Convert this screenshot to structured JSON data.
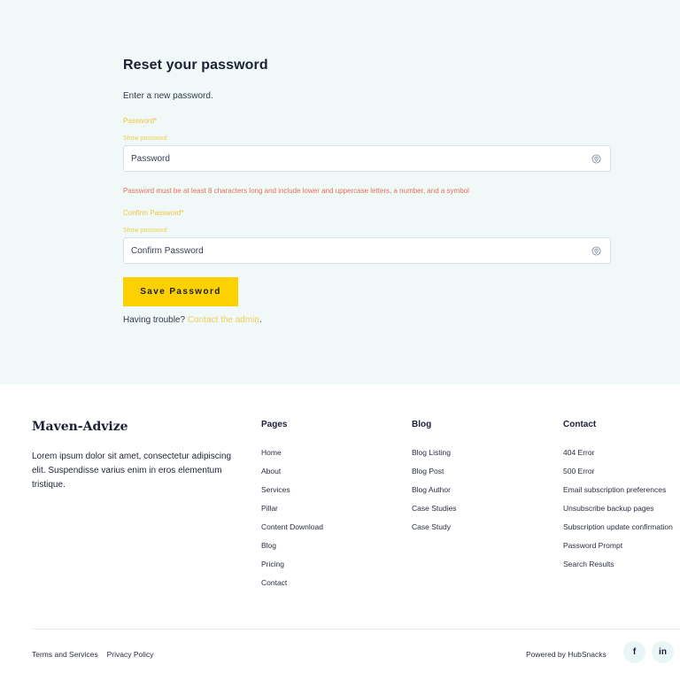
{
  "form": {
    "title": "Reset your password",
    "subtitle": "Enter a new password.",
    "password_label": "Password*",
    "show_password_1": "Show password",
    "password_placeholder": "Password",
    "error_text": "Password must be at least 8 characters long and include lower and uppercase letters, a number, and a symbol",
    "confirm_label": "Confirm Password*",
    "show_password_2": "Show password",
    "confirm_placeholder": "Confirm Password",
    "save_label": "Save Password",
    "trouble_text": "Having trouble?",
    "contact_link": "Contact the admin",
    "trouble_suffix": "."
  },
  "footer": {
    "logo": "Maven-Advize",
    "blurb": "Lorem ipsum dolor sit amet, consectetur adipiscing elit. Suspendisse varius enim in eros elementum tristique.",
    "columns": [
      {
        "title": "Pages",
        "items": [
          "Home",
          "About",
          "Services",
          "Pillar",
          "Content Download",
          "Blog",
          "Pricing",
          "Contact"
        ]
      },
      {
        "title": "Blog",
        "items": [
          "Blog Listing",
          "Blog Post",
          "Blog Author",
          "Case Studies",
          "Case Study"
        ]
      },
      {
        "title": "Contact",
        "items": [
          "404 Error",
          "500 Error",
          "Email subscription preferences",
          "Unsubscribe backup pages",
          "Subscription update confirmation",
          "Password Prompt",
          "Search Results"
        ]
      }
    ],
    "legal": [
      "Terms and Services",
      "Privacy Policy"
    ],
    "powered_by": "Powered by HubSnacks",
    "social": {
      "facebook": "f",
      "linkedin": "in"
    }
  },
  "icons": {
    "eye": "eye-icon",
    "facebook": "facebook-icon",
    "linkedin": "linkedin-icon"
  },
  "colors": {
    "accent": "#fdd000",
    "hero_bg": "#f0f9f8",
    "error": "#e8705a",
    "label": "#f0c43a"
  }
}
